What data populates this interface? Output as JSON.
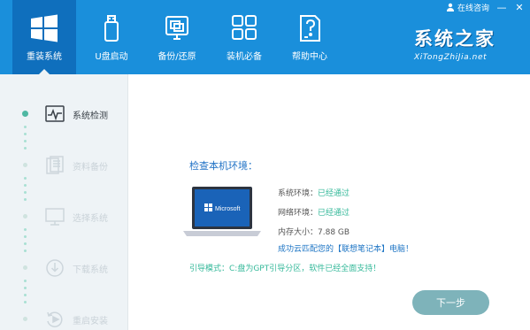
{
  "header": {
    "nav": [
      {
        "label": "重装系统",
        "icon": "windows-logo-icon",
        "active": true
      },
      {
        "label": "U盘启动",
        "icon": "usb-drive-icon",
        "active": false
      },
      {
        "label": "备份/还原",
        "icon": "backup-restore-icon",
        "active": false
      },
      {
        "label": "装机必备",
        "icon": "apps-grid-icon",
        "active": false
      },
      {
        "label": "帮助中心",
        "icon": "help-document-icon",
        "active": false
      }
    ],
    "online_consult": "在线咨询",
    "brand_title": "系统之家",
    "brand_sub": "XiTongZhiJia.net"
  },
  "sidebar": {
    "steps": [
      {
        "label": "系统检测",
        "icon": "monitor-pulse-icon",
        "active": true
      },
      {
        "label": "资料备份",
        "icon": "documents-icon",
        "active": false
      },
      {
        "label": "选择系统",
        "icon": "desktop-icon",
        "active": false
      },
      {
        "label": "下载系统",
        "icon": "download-icon",
        "active": false
      },
      {
        "label": "重启安装",
        "icon": "restart-icon",
        "active": false
      }
    ]
  },
  "main": {
    "title": "检查本机环境：",
    "laptop_logo_text": "Microsoft",
    "checks": [
      {
        "key": "系统环境：",
        "value": "已经通过",
        "status": "ok"
      },
      {
        "key": "网络环境：",
        "value": "已经通过",
        "status": "ok"
      },
      {
        "key": "内存大小：",
        "value": "7.88 GB",
        "status": "info"
      }
    ],
    "success_message": "成功云匹配您的【联想笔记本】电脑！",
    "boot_mode": "引导模式：C:盘为GPT引导分区，软件已经全面支持！",
    "next_button": "下一步"
  },
  "colors": {
    "header_bg": "#1a8fdb",
    "header_active": "#0f6fbd",
    "sidebar_bg": "#eef3f6",
    "accent_green": "#35b99a",
    "title_blue": "#2273c6",
    "button_bg": "#7eb3ba"
  }
}
